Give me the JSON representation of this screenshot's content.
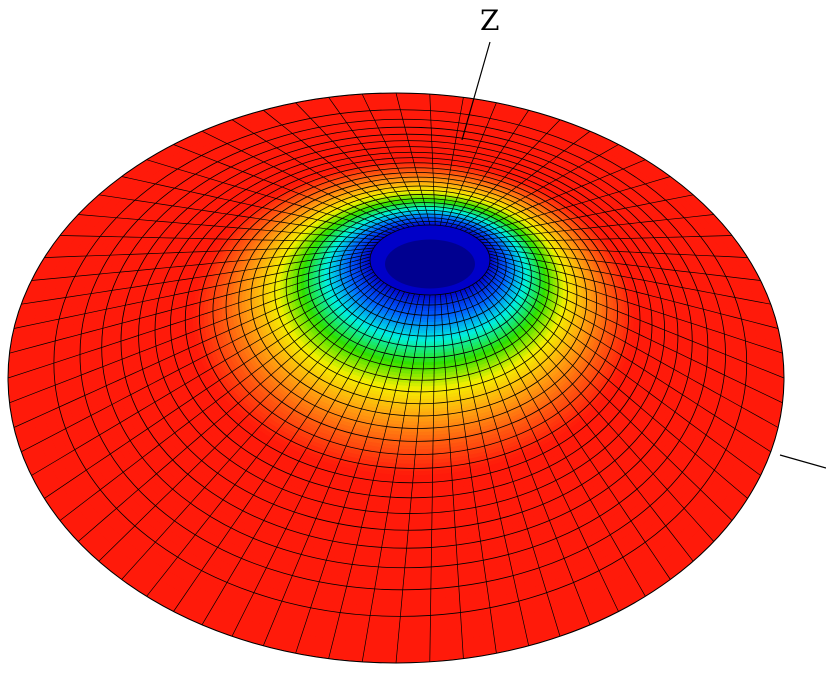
{
  "axis": {
    "z_label": "Z"
  },
  "colormap": [
    "#ff1a0a",
    "#ff5a10",
    "#ffa510",
    "#f5f000",
    "#30e000",
    "#00f0e0",
    "#0060ff",
    "#0000c8"
  ],
  "mesh": {
    "latitude_divisions": 24,
    "longitude_divisions": 72
  },
  "colors": {
    "mesh_line": "#000000",
    "axis_line": "#000000",
    "background": "#ffffff"
  }
}
